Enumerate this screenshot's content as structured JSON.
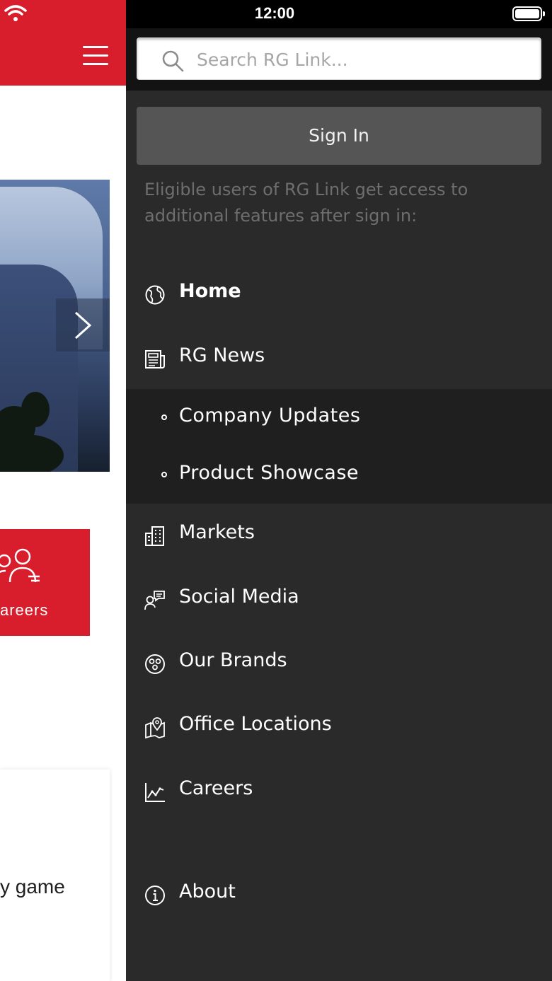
{
  "status_bar": {
    "time": "12:00"
  },
  "background_page": {
    "tile_label": "areers",
    "card_text": "y game"
  },
  "search": {
    "placeholder": "Search RG Link..."
  },
  "sign_in": {
    "label": "Sign In",
    "notice": "Eligible users of RG Link get access to additional features after sign in:"
  },
  "nav": {
    "home": "Home",
    "rg_news": "RG News",
    "company_updates": "Company Updates",
    "product_showcase": "Product Showcase",
    "markets": "Markets",
    "social_media": "Social Media",
    "our_brands": "Our Brands",
    "office_locations": "Office Locations",
    "careers": "Careers",
    "about": "About"
  },
  "colors": {
    "brand_red": "#d81e2c",
    "drawer_bg": "#2a2a2a",
    "submenu_bg": "#1f1f1f",
    "sign_in_bg": "#555555"
  },
  "icons": {
    "home": "globe-icon",
    "rg_news": "newspaper-icon",
    "markets": "buildings-icon",
    "social_media": "chat-person-icon",
    "our_brands": "brands-circle-icon",
    "office_locations": "map-pin-icon",
    "careers": "line-chart-icon",
    "about": "info-icon"
  }
}
